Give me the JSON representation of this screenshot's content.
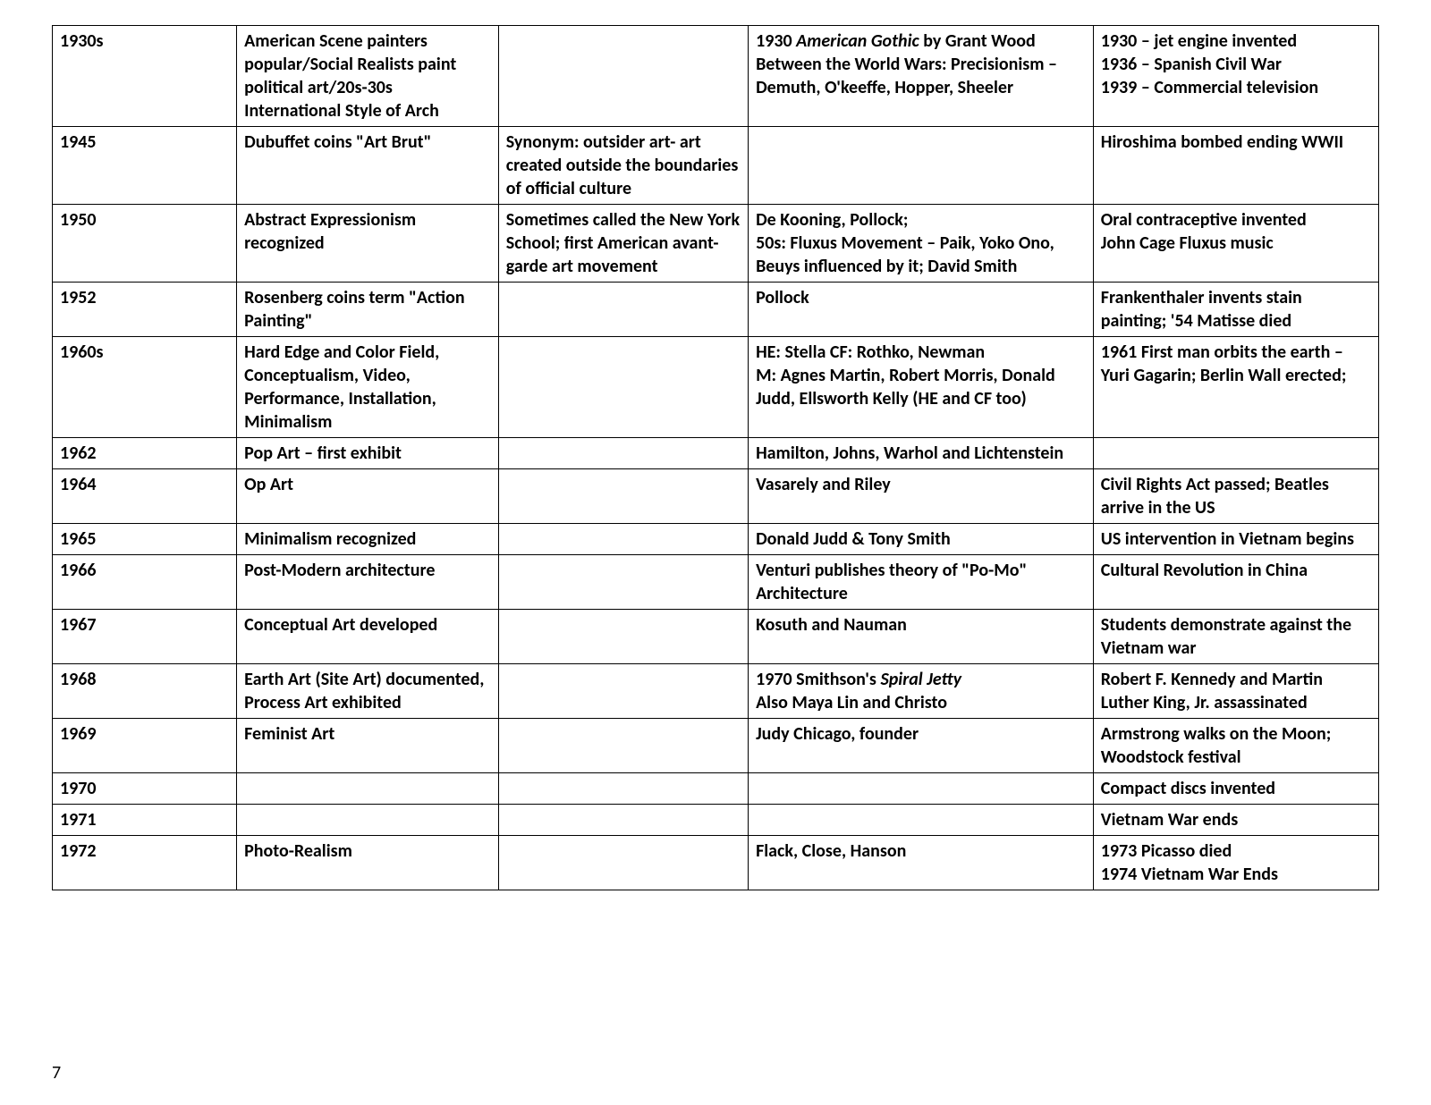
{
  "pageNumber": "7",
  "rows": [
    {
      "c0": [
        "1930s"
      ],
      "c1": [
        "American Scene painters popular/Social Realists paint political art/20s-30s International Style of Arch"
      ],
      "c2": [
        ""
      ],
      "c3": [
        {
          "pre": "1930 ",
          "it": "American Gothic",
          "post": " by Grant Wood"
        },
        "Between the World Wars: Precisionism – Demuth, O'keeffe, Hopper, Sheeler"
      ],
      "c4": [
        "1930 – jet engine invented",
        "1936 – Spanish Civil War",
        "1939 – Commercial television"
      ]
    },
    {
      "c0": [
        "1945"
      ],
      "c1": [
        "Dubuffet coins \"Art Brut\""
      ],
      "c2": [
        "Synonym: outsider art- art created outside the boundaries of official culture"
      ],
      "c3": [
        ""
      ],
      "c4": [
        "Hiroshima bombed ending WWII"
      ]
    },
    {
      "c0": [
        "1950"
      ],
      "c1": [
        "Abstract Expressionism recognized"
      ],
      "c2": [
        "Sometimes called the New York School; first American avant-garde art movement"
      ],
      "c3": [
        "De Kooning, Pollock;",
        "50s: Fluxus Movement – Paik, Yoko Ono, Beuys influenced by it; David Smith"
      ],
      "c4": [
        "Oral contraceptive invented",
        "John Cage Fluxus music"
      ]
    },
    {
      "c0": [
        "1952"
      ],
      "c1": [
        "Rosenberg coins term \"Action Painting\""
      ],
      "c2": [
        ""
      ],
      "c3": [
        "Pollock"
      ],
      "c4": [
        "Frankenthaler invents stain painting; '54 Matisse died"
      ]
    },
    {
      "c0": [
        "1960s"
      ],
      "c1": [
        "Hard Edge and Color Field, Conceptualism, Video, Performance, Installation, Minimalism"
      ],
      "c2": [
        ""
      ],
      "c3": [
        "HE: Stella  CF: Rothko, Newman",
        "M: Agnes Martin, Robert Morris, Donald Judd, Ellsworth Kelly (HE and CF too)"
      ],
      "c4": [
        "1961 First man orbits the earth – Yuri Gagarin; Berlin Wall erected;"
      ]
    },
    {
      "c0": [
        "1962"
      ],
      "c1": [
        "Pop Art – first exhibit"
      ],
      "c2": [
        ""
      ],
      "c3": [
        "Hamilton, Johns, Warhol and Lichtenstein"
      ],
      "c4": [
        ""
      ]
    },
    {
      "c0": [
        "1964"
      ],
      "c1": [
        "Op Art"
      ],
      "c2": [
        ""
      ],
      "c3": [
        "Vasarely and Riley"
      ],
      "c4": [
        "Civil Rights Act passed; Beatles arrive in the US"
      ]
    },
    {
      "c0": [
        "1965"
      ],
      "c1": [
        "Minimalism recognized"
      ],
      "c2": [
        ""
      ],
      "c3": [
        "Donald Judd & Tony Smith"
      ],
      "c4": [
        "US intervention in Vietnam begins"
      ]
    },
    {
      "c0": [
        "1966"
      ],
      "c1": [
        "Post-Modern architecture"
      ],
      "c2": [
        ""
      ],
      "c3": [
        "Venturi publishes theory of \"Po-Mo\" Architecture"
      ],
      "c4": [
        "Cultural Revolution in China"
      ]
    },
    {
      "c0": [
        "1967"
      ],
      "c1": [
        "Conceptual Art developed"
      ],
      "c2": [
        ""
      ],
      "c3": [
        "Kosuth and Nauman"
      ],
      "c4": [
        "Students demonstrate against the Vietnam war"
      ]
    },
    {
      "c0": [
        "1968"
      ],
      "c1": [
        "Earth Art (Site Art) documented, Process Art exhibited"
      ],
      "c2": [
        ""
      ],
      "c3": [
        {
          "pre": "1970 Smithson's ",
          "it": "Spiral Jetty",
          "post": ""
        },
        "Also Maya Lin and Christo"
      ],
      "c4": [
        "Robert F. Kennedy and Martin Luther King, Jr. assassinated"
      ]
    },
    {
      "c0": [
        "1969"
      ],
      "c1": [
        "Feminist Art"
      ],
      "c2": [
        ""
      ],
      "c3": [
        "Judy Chicago, founder"
      ],
      "c4": [
        "Armstrong walks on the Moon; Woodstock festival"
      ]
    },
    {
      "c0": [
        "1970"
      ],
      "c1": [
        ""
      ],
      "c2": [
        ""
      ],
      "c3": [
        ""
      ],
      "c4": [
        "Compact discs invented"
      ]
    },
    {
      "c0": [
        "1971"
      ],
      "c1": [
        ""
      ],
      "c2": [
        ""
      ],
      "c3": [
        ""
      ],
      "c4": [
        "Vietnam War ends"
      ]
    },
    {
      "c0": [
        "1972"
      ],
      "c1": [
        "Photo-Realism"
      ],
      "c2": [
        ""
      ],
      "c3": [
        "Flack, Close, Hanson"
      ],
      "c4": [
        "1973 Picasso died",
        "1974 Vietnam War Ends"
      ]
    }
  ]
}
